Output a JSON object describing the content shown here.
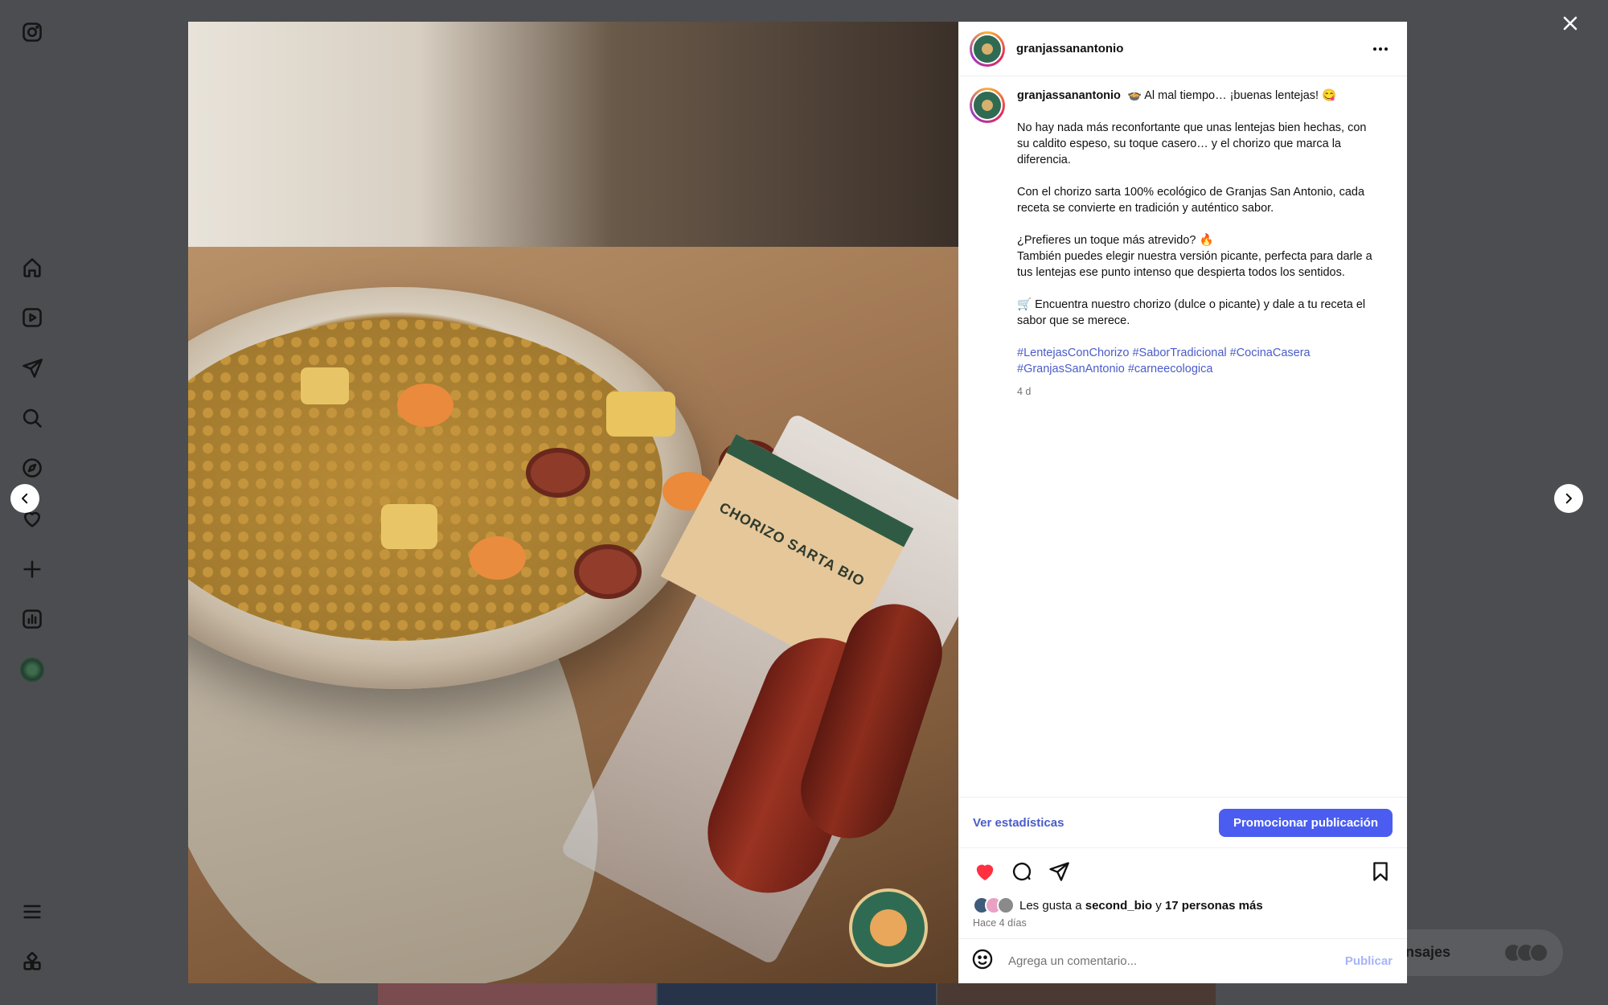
{
  "sidebar": {
    "items": [
      {
        "icon": "instagram-icon"
      },
      {
        "icon": "home-icon"
      },
      {
        "icon": "reels-icon"
      },
      {
        "icon": "direct-send-icon"
      },
      {
        "icon": "search-icon"
      },
      {
        "icon": "explore-compass-icon"
      },
      {
        "icon": "heart-icon"
      },
      {
        "icon": "plus-icon"
      },
      {
        "icon": "dashboard-icon"
      },
      {
        "icon": "profile-avatar"
      },
      {
        "icon": "menu-icon"
      },
      {
        "icon": "grid-apps-icon"
      }
    ]
  },
  "messages_pill": {
    "label": "nsajes"
  },
  "post": {
    "header": {
      "username": "granjassanantonio"
    },
    "caption": {
      "username": "granjassanantonio",
      "first_line": "🍲 Al mal tiempo… ¡buenas lentejas! 😋",
      "paragraphs": [
        "No hay nada más reconfortante que unas lentejas bien hechas, con su caldito espeso, su toque casero… y el chorizo que marca la diferencia.",
        "Con el chorizo sarta 100% ecológico de Granjas San Antonio, cada receta se convierte en tradición y auténtico sabor.",
        "¿Prefieres un toque más atrevido? 🔥\nTambién puedes elegir nuestra versión picante, perfecta para darle a tus lentejas ese punto intenso que despierta todos los sentidos.",
        "🛒 Encuentra nuestro chorizo (dulce o picante) y dale a tu receta el sabor que se merece."
      ],
      "hashtags": "#LentejasConChorizo #SaborTradicional #CocinaCasera #GranjasSanAntonio #carneecologica",
      "time": "4 d"
    },
    "stats_link": "Ver estadísticas",
    "promote_button": "Promocionar publicación",
    "likes": {
      "prefix": "Les gusta a",
      "user": "second_bio",
      "connector": "y",
      "others": "17 personas más",
      "time": "Hace 4 días"
    },
    "comment": {
      "placeholder": "Agrega un comentario...",
      "publish": "Publicar"
    },
    "image_label": "CHORIZO SARTA BIO",
    "liked": true,
    "colors": {
      "accent": "#4a5df0",
      "link": "#4a5cc9",
      "like": "#ff3040"
    }
  }
}
